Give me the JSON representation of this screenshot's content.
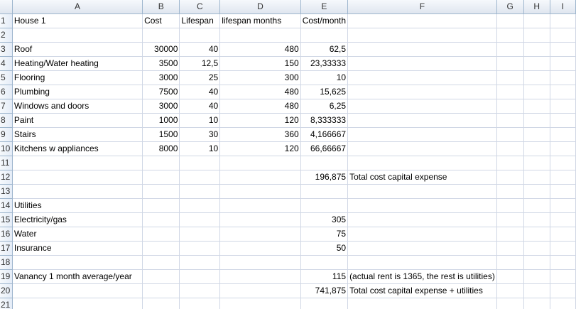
{
  "columns": [
    "A",
    "B",
    "C",
    "D",
    "E",
    "F",
    "G",
    "H",
    "I"
  ],
  "rows": [
    {
      "n": "1",
      "A": "House 1",
      "B": "Cost",
      "C": "Lifespan",
      "D": "lifespan months",
      "E": "Cost/month",
      "F": ""
    },
    {
      "n": "2",
      "A": "",
      "B": "",
      "C": "",
      "D": "",
      "E": "",
      "F": ""
    },
    {
      "n": "3",
      "A": "Roof",
      "B": "30000",
      "C": "40",
      "D": "480",
      "E": "62,5",
      "F": ""
    },
    {
      "n": "4",
      "A": "Heating/Water heating",
      "B": "3500",
      "C": "12,5",
      "D": "150",
      "E": "23,33333",
      "F": ""
    },
    {
      "n": "5",
      "A": "Flooring",
      "B": "3000",
      "C": "25",
      "D": "300",
      "E": "10",
      "F": ""
    },
    {
      "n": "6",
      "A": "Plumbing",
      "B": "7500",
      "C": "40",
      "D": "480",
      "E": "15,625",
      "F": ""
    },
    {
      "n": "7",
      "A": "Windows and doors",
      "B": "3000",
      "C": "40",
      "D": "480",
      "E": "6,25",
      "F": ""
    },
    {
      "n": "8",
      "A": "Paint",
      "B": "1000",
      "C": "10",
      "D": "120",
      "E": "8,333333",
      "F": ""
    },
    {
      "n": "9",
      "A": "Stairs",
      "B": "1500",
      "C": "30",
      "D": "360",
      "E": "4,166667",
      "F": ""
    },
    {
      "n": "10",
      "A": "Kitchens w appliances",
      "B": "8000",
      "C": "10",
      "D": "120",
      "E": "66,66667",
      "F": ""
    },
    {
      "n": "11",
      "A": "",
      "B": "",
      "C": "",
      "D": "",
      "E": "",
      "F": ""
    },
    {
      "n": "12",
      "A": "",
      "B": "",
      "C": "",
      "D": "",
      "E": "196,875",
      "F": "Total cost capital expense"
    },
    {
      "n": "13",
      "A": "",
      "B": "",
      "C": "",
      "D": "",
      "E": "",
      "F": ""
    },
    {
      "n": "14",
      "A": "Utilities",
      "B": "",
      "C": "",
      "D": "",
      "E": "",
      "F": ""
    },
    {
      "n": "15",
      "A": "Electricity/gas",
      "B": "",
      "C": "",
      "D": "",
      "E": "305",
      "F": ""
    },
    {
      "n": "16",
      "A": "Water",
      "B": "",
      "C": "",
      "D": "",
      "E": "75",
      "F": ""
    },
    {
      "n": "17",
      "A": "Insurance",
      "B": "",
      "C": "",
      "D": "",
      "E": "50",
      "F": ""
    },
    {
      "n": "18",
      "A": "",
      "B": "",
      "C": "",
      "D": "",
      "E": "",
      "F": ""
    },
    {
      "n": "19",
      "A": "Vanancy 1 month average/year",
      "B": "",
      "C": "",
      "D": "",
      "E": "115",
      "F": "(actual rent is 1365, the rest is utilities)"
    },
    {
      "n": "20",
      "A": "",
      "B": "",
      "C": "",
      "D": "",
      "E": "741,875",
      "F": "Total cost capital expense + utilities"
    },
    {
      "n": "21",
      "A": "",
      "B": "",
      "C": "",
      "D": "",
      "E": "",
      "F": ""
    }
  ],
  "colors": {
    "grid": "#d0d7e5",
    "header_bg": "#dfe6ef",
    "header_border": "#9eb6ce"
  }
}
